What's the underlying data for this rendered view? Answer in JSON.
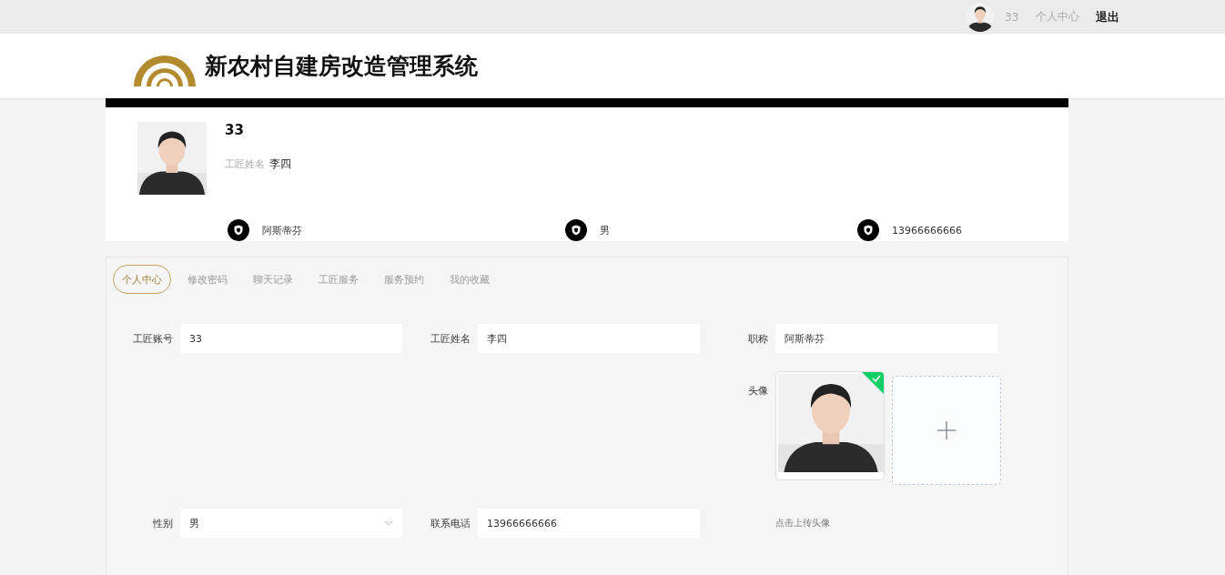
{
  "top_bar": {
    "username": "33",
    "account_link": "个人中心",
    "logout": "退出"
  },
  "header": {
    "title": "新农村自建房改造管理系统"
  },
  "profile": {
    "account": "33",
    "name_label": "工匠姓名",
    "name": "李四",
    "facts": [
      "阿斯蒂芬",
      "男",
      "13966666666"
    ]
  },
  "tabs": [
    {
      "label": "个人中心",
      "selected": true
    },
    {
      "label": "修改密码",
      "selected": false
    },
    {
      "label": "聊天记录",
      "selected": false
    },
    {
      "label": "工匠服务",
      "selected": false
    },
    {
      "label": "服务预约",
      "selected": false
    },
    {
      "label": "我的收藏",
      "selected": false
    }
  ],
  "form": {
    "rows": [
      [
        {
          "label": "工匠账号",
          "value": "33",
          "kind": "text"
        },
        {
          "label": "工匠姓名",
          "value": "李四",
          "kind": "text"
        },
        {
          "label": "职称",
          "value": "阿斯蒂芬",
          "kind": "text"
        }
      ],
      [
        {
          "label": "性别",
          "value": "男",
          "kind": "select"
        },
        {
          "label": "联系电话",
          "value": "13966666666",
          "kind": "text"
        }
      ]
    ],
    "avatar": {
      "label": "头像",
      "uploaded": true,
      "hint": "点击上传头像"
    }
  }
}
